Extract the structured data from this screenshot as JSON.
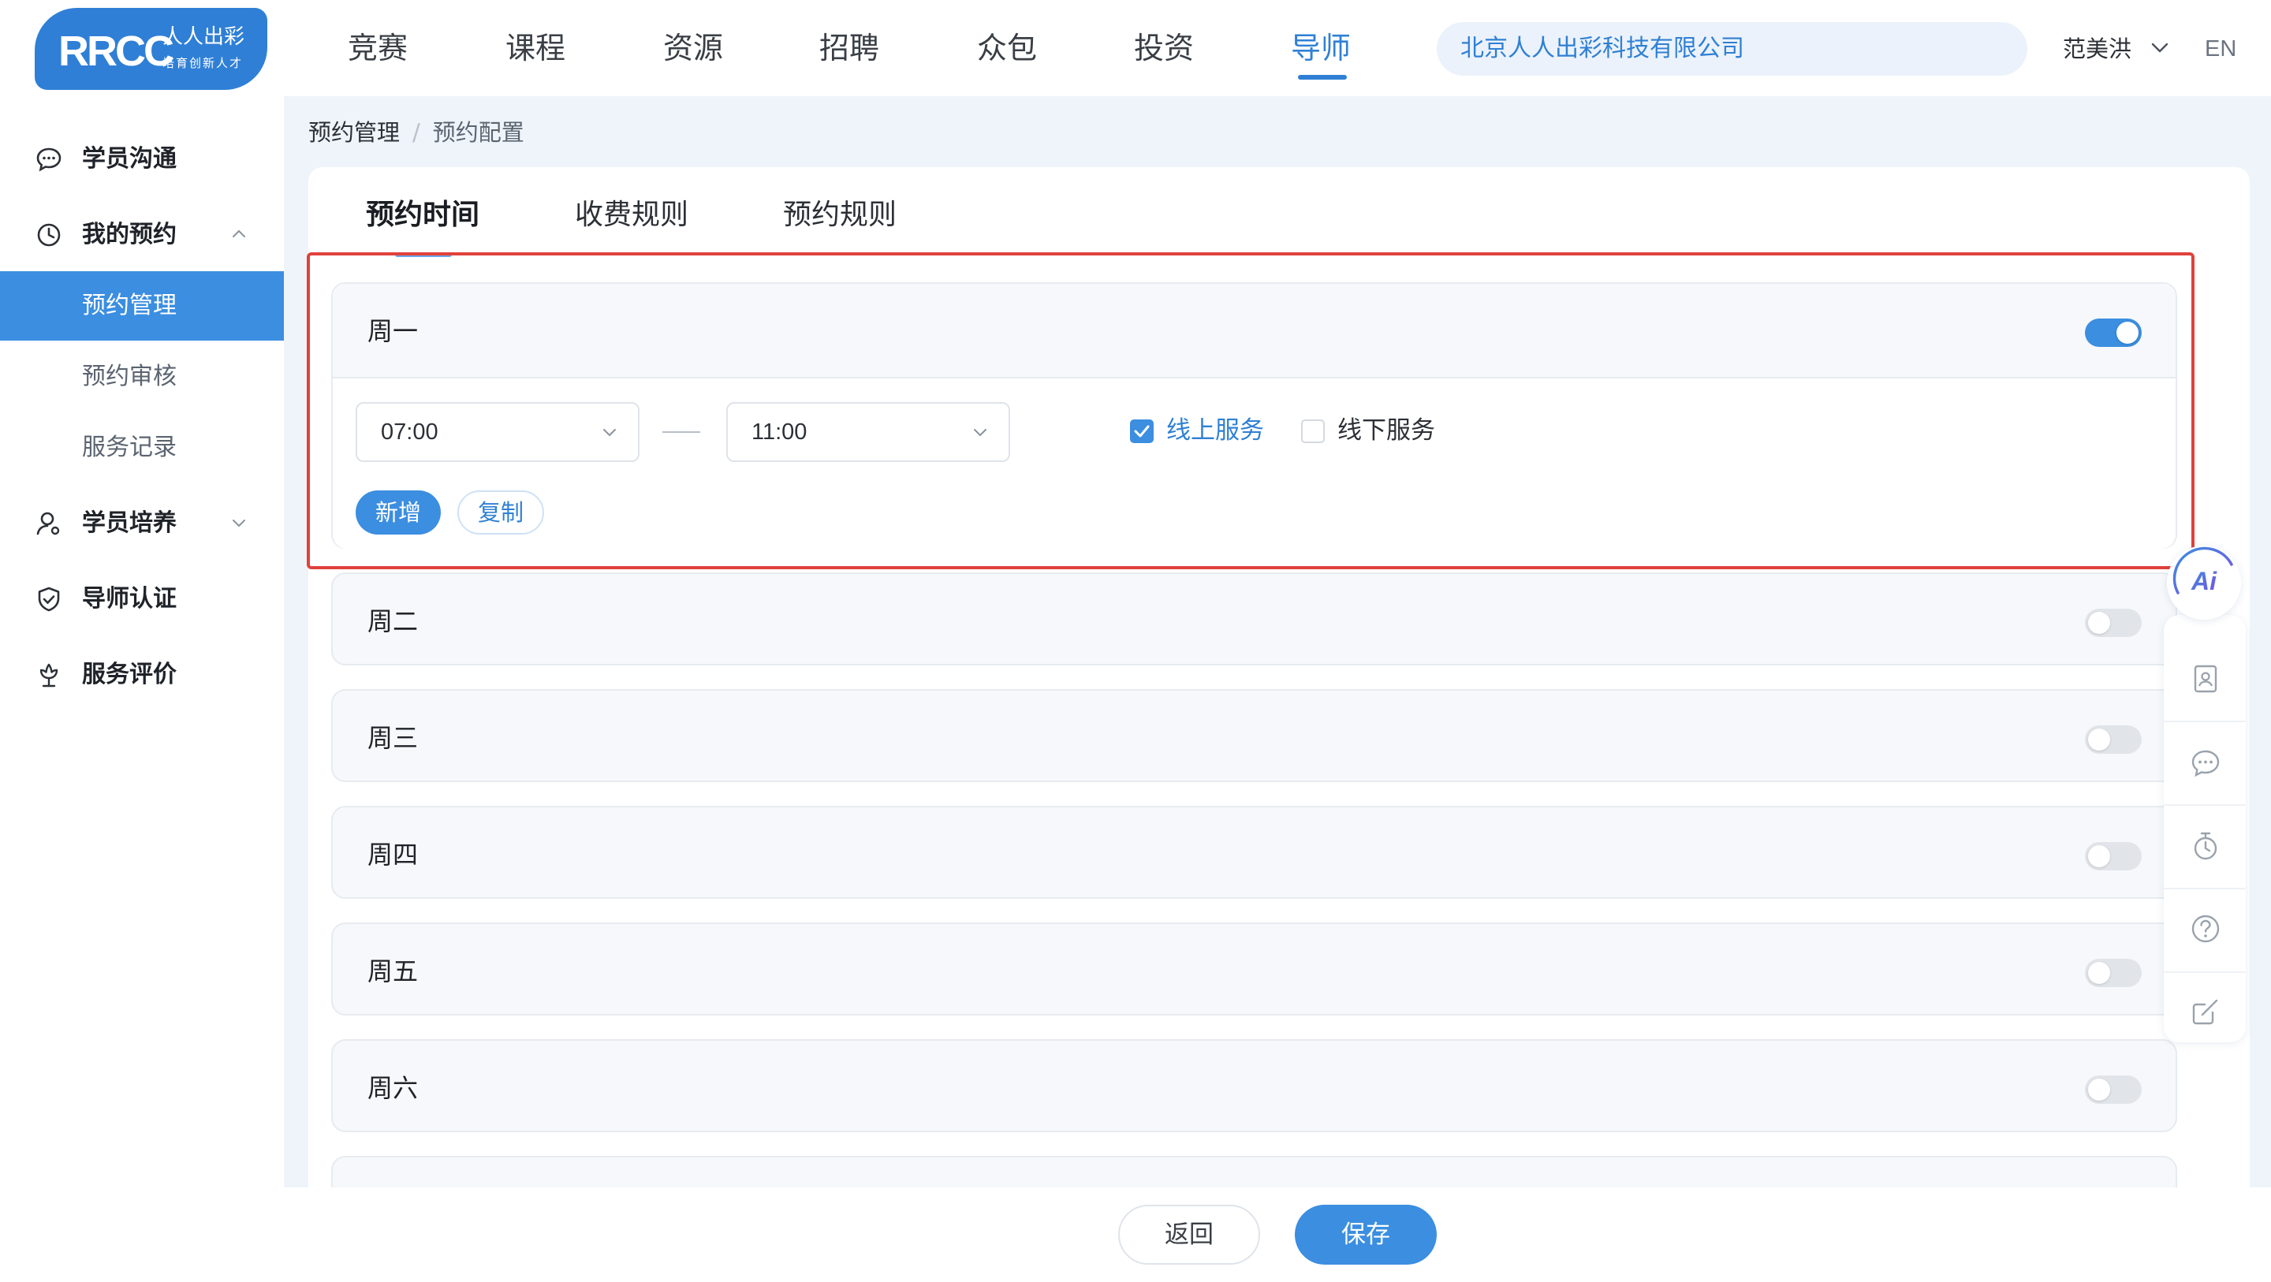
{
  "header": {
    "logo": {
      "main": "RRCC",
      "cn": "人人出彩",
      "sub": "培育创新人才"
    },
    "nav": [
      "竞赛",
      "课程",
      "资源",
      "招聘",
      "众包",
      "投资",
      "导师"
    ],
    "active_nav": "导师",
    "company": "北京人人出彩科技有限公司",
    "user_name": "范美洪",
    "lang": "EN"
  },
  "sidebar": {
    "items": [
      {
        "label": "学员沟通",
        "icon": "chat-icon"
      },
      {
        "label": "我的预约",
        "icon": "clock-icon",
        "expanded": true
      },
      {
        "label": "学员培养",
        "icon": "user-icon",
        "expanded": false
      },
      {
        "label": "导师认证",
        "icon": "shield-icon"
      },
      {
        "label": "服务评价",
        "icon": "flower-icon"
      }
    ],
    "sub_items": [
      "预约管理",
      "预约审核",
      "服务记录"
    ],
    "active_sub": "预约管理"
  },
  "breadcrumb": {
    "parent": "预约管理",
    "separator": "/",
    "current": "预约配置"
  },
  "tabs": [
    "预约时间",
    "收费规则",
    "预约规则"
  ],
  "active_tab": "预约时间",
  "days": [
    {
      "label": "周一",
      "enabled": true
    },
    {
      "label": "周二",
      "enabled": false
    },
    {
      "label": "周三",
      "enabled": false
    },
    {
      "label": "周四",
      "enabled": false
    },
    {
      "label": "周五",
      "enabled": false
    },
    {
      "label": "周六",
      "enabled": false
    }
  ],
  "monday_slot": {
    "start": "07:00",
    "end": "11:00",
    "online_label": "线上服务",
    "online_checked": true,
    "offline_label": "线下服务",
    "offline_checked": false,
    "add_label": "新增",
    "copy_label": "复制"
  },
  "float": {
    "ai_label": "Ai"
  },
  "tools": [
    "contact-card-icon",
    "comment-icon",
    "timer-icon",
    "help-icon",
    "edit-icon"
  ],
  "footer": {
    "back_label": "返回",
    "save_label": "保存"
  },
  "colors": {
    "primary": "#3b8ee0",
    "highlight_border": "#e0413c",
    "page_bg": "#eef4fa"
  }
}
